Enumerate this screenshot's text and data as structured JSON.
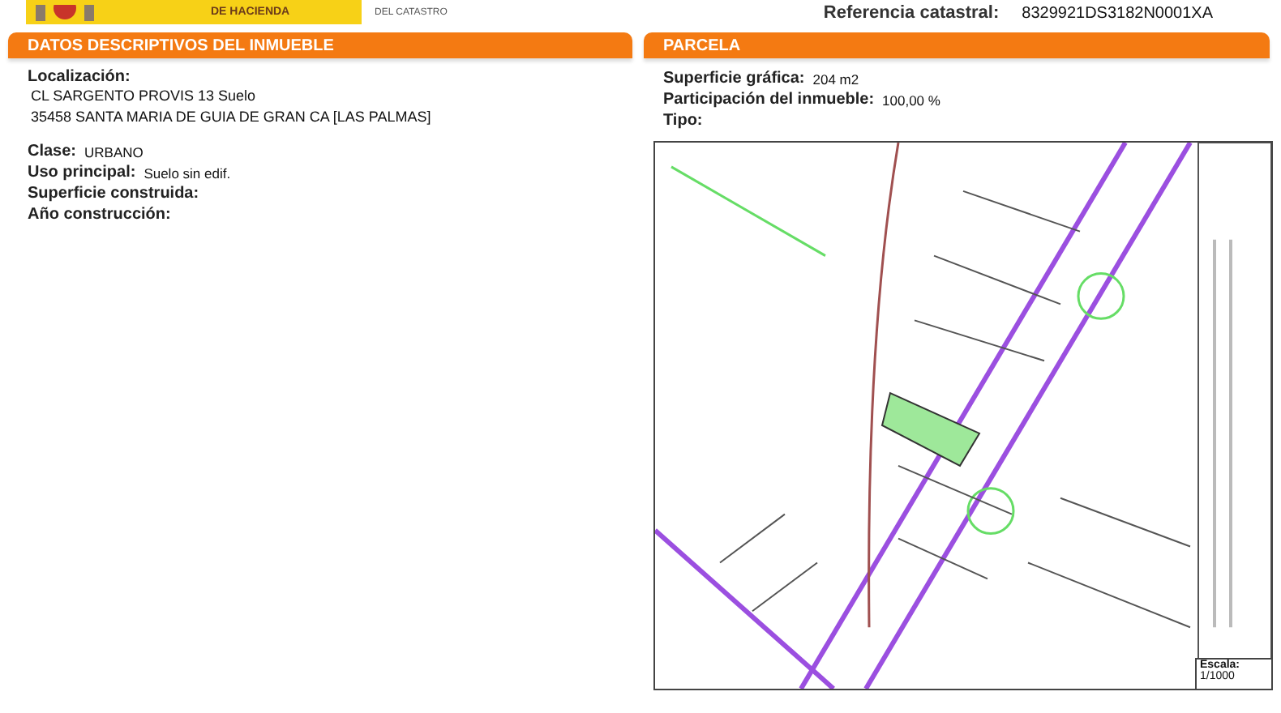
{
  "header": {
    "ministry_line": "DE HACIENDA",
    "agency_line": "DEL CATASTRO",
    "reference_label": "Referencia catastral:",
    "reference_value": "8329921DS3182N0001XA"
  },
  "inmueble": {
    "title": "DATOS DESCRIPTIVOS DEL INMUEBLE",
    "location_label": "Localización:",
    "address_lines": [
      "CL SARGENTO PROVIS 13 Suelo",
      "35458 SANTA MARIA DE GUIA DE GRAN CA [LAS PALMAS]"
    ],
    "fields": [
      {
        "label": "Clase:",
        "value": "URBANO"
      },
      {
        "label": "Uso principal:",
        "value": "Suelo sin edif."
      },
      {
        "label": "Superficie construida:"
      },
      {
        "label": "Año construcción:"
      }
    ]
  },
  "parcela": {
    "title": "PARCELA",
    "fields": [
      {
        "label": "Superficie gráfica:",
        "value": "204 m2"
      },
      {
        "label": "Participación del inmueble:",
        "value": "100,00 %"
      },
      {
        "label": "Tipo:"
      }
    ],
    "map": {
      "kind": "picture",
      "scale_label": "Escala:",
      "scale_value": "1/1000"
    }
  }
}
